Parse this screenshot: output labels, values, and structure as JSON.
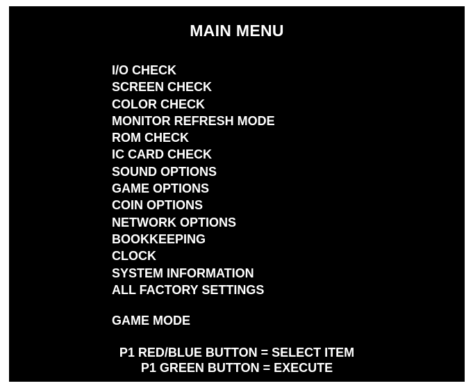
{
  "menu": {
    "title": "MAIN MENU",
    "items": [
      "I/O CHECK",
      "SCREEN CHECK",
      "COLOR CHECK",
      "MONITOR REFRESH MODE",
      "ROM CHECK",
      "IC CARD CHECK",
      "SOUND OPTIONS",
      "GAME OPTIONS",
      "COIN OPTIONS",
      "NETWORK OPTIONS",
      "BOOKKEEPING",
      "CLOCK",
      "SYSTEM INFORMATION",
      "ALL FACTORY SETTINGS"
    ],
    "game_mode": "GAME MODE"
  },
  "instructions": {
    "select": "P1 RED/BLUE BUTTON = SELECT ITEM",
    "execute": "P1 GREEN BUTTON = EXECUTE"
  },
  "colors": {
    "background": "#000000",
    "text": "#ffffff"
  }
}
